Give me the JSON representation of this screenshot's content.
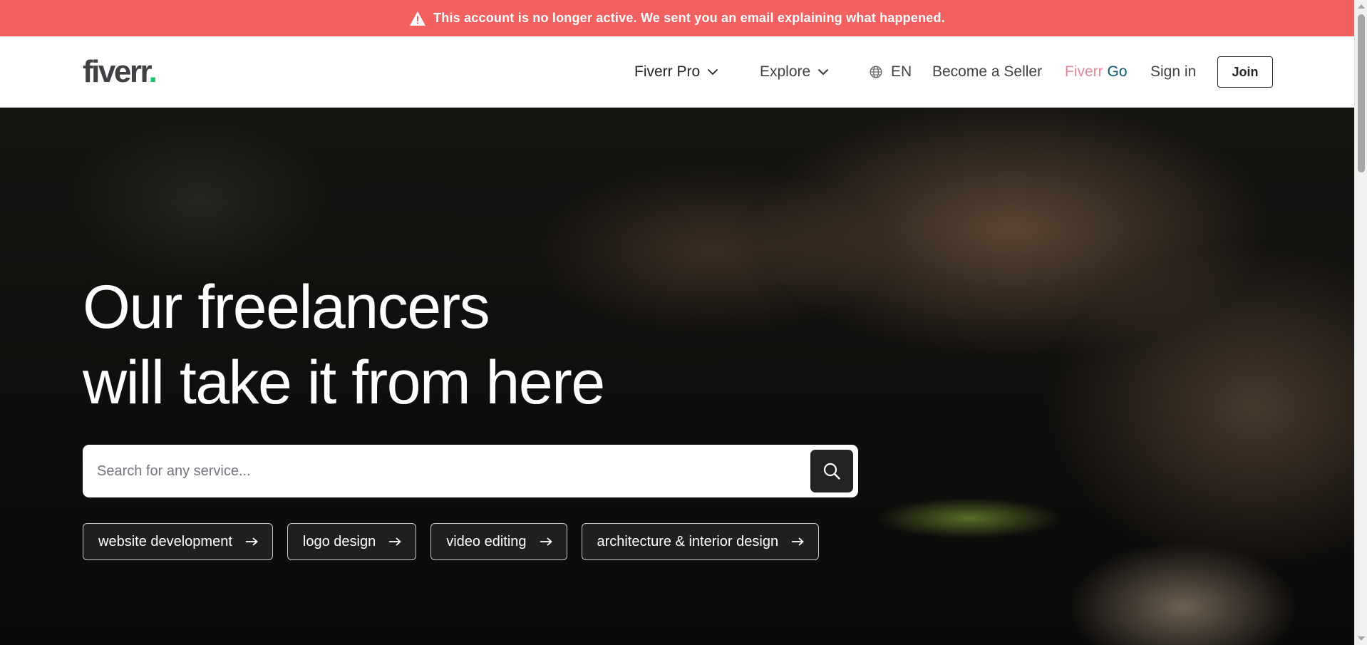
{
  "alert": {
    "text": "This account is no longer active. We sent you an email explaining what happened.",
    "icon": "warning-icon",
    "color": "#f26060"
  },
  "header": {
    "logo": {
      "text": "fiverr",
      "dot": ".",
      "dot_color": "#1dbf73"
    },
    "nav": {
      "fiverr_pro": "Fiverr Pro",
      "explore": "Explore",
      "language": "EN",
      "become_seller": "Become a Seller",
      "fiverr_go_a": "Fiverr",
      "fiverr_go_b": "Go",
      "sign_in": "Sign in",
      "join": "Join"
    }
  },
  "hero": {
    "title_line1": "Our freelancers",
    "title_line2": "will take it from here",
    "search": {
      "placeholder": "Search for any service...",
      "value": "",
      "icon": "search-icon"
    },
    "chips": [
      {
        "label": "website development"
      },
      {
        "label": "logo design"
      },
      {
        "label": "video editing"
      },
      {
        "label": "architecture & interior design"
      }
    ]
  },
  "colors": {
    "text_dark": "#222325",
    "text_gray": "#404145",
    "brand_green": "#1dbf73"
  }
}
